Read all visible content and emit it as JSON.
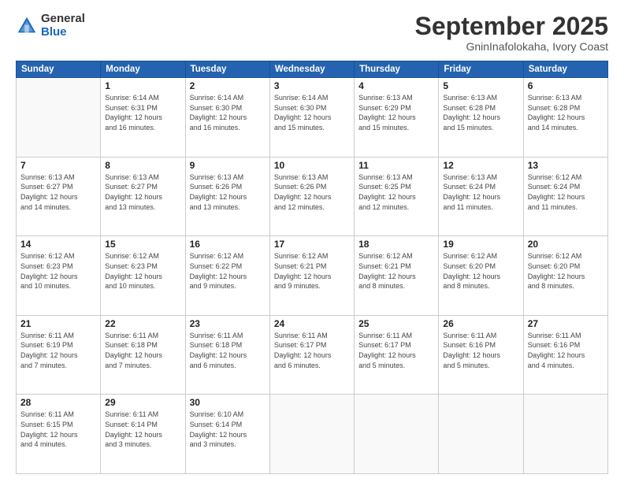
{
  "logo": {
    "general": "General",
    "blue": "Blue"
  },
  "title": "September 2025",
  "subtitle": "GninInafolokaha, Ivory Coast",
  "headers": [
    "Sunday",
    "Monday",
    "Tuesday",
    "Wednesday",
    "Thursday",
    "Friday",
    "Saturday"
  ],
  "weeks": [
    [
      {
        "day": "",
        "info": ""
      },
      {
        "day": "1",
        "info": "Sunrise: 6:14 AM\nSunset: 6:31 PM\nDaylight: 12 hours\nand 16 minutes."
      },
      {
        "day": "2",
        "info": "Sunrise: 6:14 AM\nSunset: 6:30 PM\nDaylight: 12 hours\nand 16 minutes."
      },
      {
        "day": "3",
        "info": "Sunrise: 6:14 AM\nSunset: 6:30 PM\nDaylight: 12 hours\nand 15 minutes."
      },
      {
        "day": "4",
        "info": "Sunrise: 6:13 AM\nSunset: 6:29 PM\nDaylight: 12 hours\nand 15 minutes."
      },
      {
        "day": "5",
        "info": "Sunrise: 6:13 AM\nSunset: 6:28 PM\nDaylight: 12 hours\nand 15 minutes."
      },
      {
        "day": "6",
        "info": "Sunrise: 6:13 AM\nSunset: 6:28 PM\nDaylight: 12 hours\nand 14 minutes."
      }
    ],
    [
      {
        "day": "7",
        "info": "Sunrise: 6:13 AM\nSunset: 6:27 PM\nDaylight: 12 hours\nand 14 minutes."
      },
      {
        "day": "8",
        "info": "Sunrise: 6:13 AM\nSunset: 6:27 PM\nDaylight: 12 hours\nand 13 minutes."
      },
      {
        "day": "9",
        "info": "Sunrise: 6:13 AM\nSunset: 6:26 PM\nDaylight: 12 hours\nand 13 minutes."
      },
      {
        "day": "10",
        "info": "Sunrise: 6:13 AM\nSunset: 6:26 PM\nDaylight: 12 hours\nand 12 minutes."
      },
      {
        "day": "11",
        "info": "Sunrise: 6:13 AM\nSunset: 6:25 PM\nDaylight: 12 hours\nand 12 minutes."
      },
      {
        "day": "12",
        "info": "Sunrise: 6:13 AM\nSunset: 6:24 PM\nDaylight: 12 hours\nand 11 minutes."
      },
      {
        "day": "13",
        "info": "Sunrise: 6:12 AM\nSunset: 6:24 PM\nDaylight: 12 hours\nand 11 minutes."
      }
    ],
    [
      {
        "day": "14",
        "info": "Sunrise: 6:12 AM\nSunset: 6:23 PM\nDaylight: 12 hours\nand 10 minutes."
      },
      {
        "day": "15",
        "info": "Sunrise: 6:12 AM\nSunset: 6:23 PM\nDaylight: 12 hours\nand 10 minutes."
      },
      {
        "day": "16",
        "info": "Sunrise: 6:12 AM\nSunset: 6:22 PM\nDaylight: 12 hours\nand 9 minutes."
      },
      {
        "day": "17",
        "info": "Sunrise: 6:12 AM\nSunset: 6:21 PM\nDaylight: 12 hours\nand 9 minutes."
      },
      {
        "day": "18",
        "info": "Sunrise: 6:12 AM\nSunset: 6:21 PM\nDaylight: 12 hours\nand 8 minutes."
      },
      {
        "day": "19",
        "info": "Sunrise: 6:12 AM\nSunset: 6:20 PM\nDaylight: 12 hours\nand 8 minutes."
      },
      {
        "day": "20",
        "info": "Sunrise: 6:12 AM\nSunset: 6:20 PM\nDaylight: 12 hours\nand 8 minutes."
      }
    ],
    [
      {
        "day": "21",
        "info": "Sunrise: 6:11 AM\nSunset: 6:19 PM\nDaylight: 12 hours\nand 7 minutes."
      },
      {
        "day": "22",
        "info": "Sunrise: 6:11 AM\nSunset: 6:18 PM\nDaylight: 12 hours\nand 7 minutes."
      },
      {
        "day": "23",
        "info": "Sunrise: 6:11 AM\nSunset: 6:18 PM\nDaylight: 12 hours\nand 6 minutes."
      },
      {
        "day": "24",
        "info": "Sunrise: 6:11 AM\nSunset: 6:17 PM\nDaylight: 12 hours\nand 6 minutes."
      },
      {
        "day": "25",
        "info": "Sunrise: 6:11 AM\nSunset: 6:17 PM\nDaylight: 12 hours\nand 5 minutes."
      },
      {
        "day": "26",
        "info": "Sunrise: 6:11 AM\nSunset: 6:16 PM\nDaylight: 12 hours\nand 5 minutes."
      },
      {
        "day": "27",
        "info": "Sunrise: 6:11 AM\nSunset: 6:16 PM\nDaylight: 12 hours\nand 4 minutes."
      }
    ],
    [
      {
        "day": "28",
        "info": "Sunrise: 6:11 AM\nSunset: 6:15 PM\nDaylight: 12 hours\nand 4 minutes."
      },
      {
        "day": "29",
        "info": "Sunrise: 6:11 AM\nSunset: 6:14 PM\nDaylight: 12 hours\nand 3 minutes."
      },
      {
        "day": "30",
        "info": "Sunrise: 6:10 AM\nSunset: 6:14 PM\nDaylight: 12 hours\nand 3 minutes."
      },
      {
        "day": "",
        "info": ""
      },
      {
        "day": "",
        "info": ""
      },
      {
        "day": "",
        "info": ""
      },
      {
        "day": "",
        "info": ""
      }
    ]
  ]
}
